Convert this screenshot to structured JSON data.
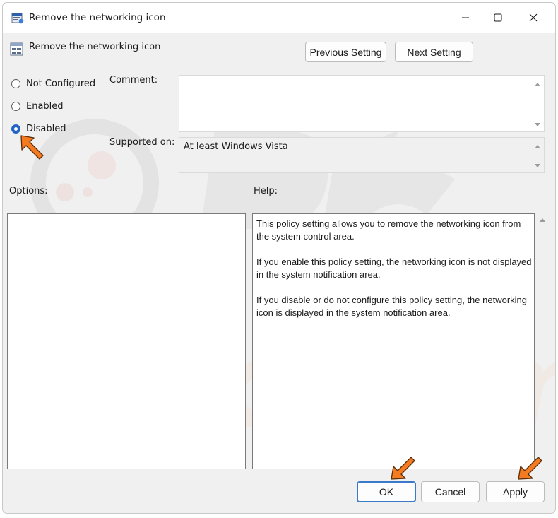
{
  "window": {
    "title": "Remove the networking icon",
    "minimize_icon": "minimize-icon",
    "maximize_icon": "maximize-icon",
    "close_icon": "close-icon"
  },
  "header": {
    "title": "Remove the networking icon",
    "previous_label": "Previous Setting",
    "next_label": "Next Setting"
  },
  "radio": {
    "not_configured": "Not Configured",
    "enabled": "Enabled",
    "disabled": "Disabled",
    "selected": "disabled"
  },
  "fields": {
    "comment_label": "Comment:",
    "supported_label": "Supported on:",
    "supported_value": "At least Windows Vista",
    "options_label": "Options:",
    "help_label": "Help:"
  },
  "help": {
    "p1": "This policy setting allows you to remove the networking icon from the system control area.",
    "p2": "If you enable this policy setting, the networking icon is not displayed in the system notification area.",
    "p3": "If you disable or do not configure this policy setting, the networking icon is displayed in the system notification area."
  },
  "footer": {
    "ok_label": "OK",
    "cancel_label": "Cancel",
    "apply_label": "Apply"
  },
  "colors": {
    "accent": "#2364c6",
    "arrow": "#f47b20"
  }
}
